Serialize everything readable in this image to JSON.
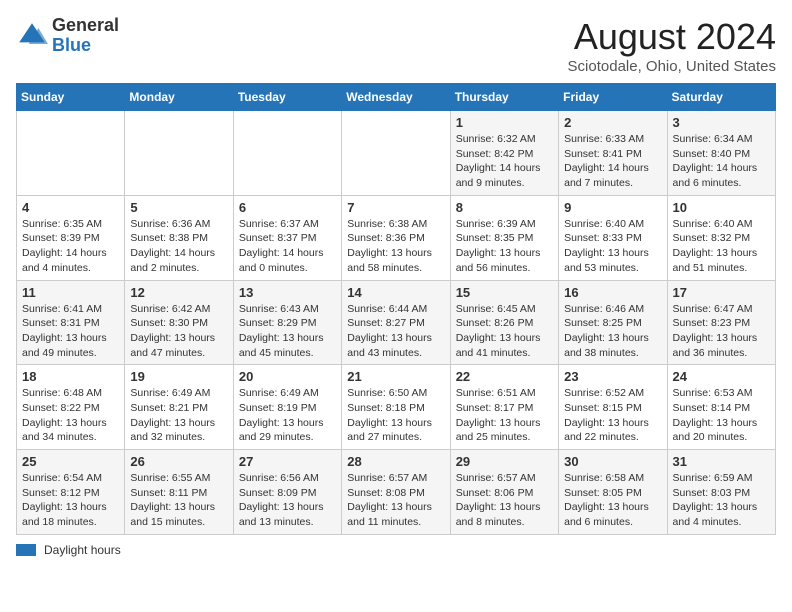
{
  "header": {
    "logo_general": "General",
    "logo_blue": "Blue",
    "month_title": "August 2024",
    "location": "Sciotodale, Ohio, United States"
  },
  "days_of_week": [
    "Sunday",
    "Monday",
    "Tuesday",
    "Wednesday",
    "Thursday",
    "Friday",
    "Saturday"
  ],
  "legend": {
    "label": "Daylight hours"
  },
  "weeks": [
    [
      {
        "day": "",
        "info": ""
      },
      {
        "day": "",
        "info": ""
      },
      {
        "day": "",
        "info": ""
      },
      {
        "day": "",
        "info": ""
      },
      {
        "day": "1",
        "info": "Sunrise: 6:32 AM\nSunset: 8:42 PM\nDaylight: 14 hours and 9 minutes."
      },
      {
        "day": "2",
        "info": "Sunrise: 6:33 AM\nSunset: 8:41 PM\nDaylight: 14 hours and 7 minutes."
      },
      {
        "day": "3",
        "info": "Sunrise: 6:34 AM\nSunset: 8:40 PM\nDaylight: 14 hours and 6 minutes."
      }
    ],
    [
      {
        "day": "4",
        "info": "Sunrise: 6:35 AM\nSunset: 8:39 PM\nDaylight: 14 hours and 4 minutes."
      },
      {
        "day": "5",
        "info": "Sunrise: 6:36 AM\nSunset: 8:38 PM\nDaylight: 14 hours and 2 minutes."
      },
      {
        "day": "6",
        "info": "Sunrise: 6:37 AM\nSunset: 8:37 PM\nDaylight: 14 hours and 0 minutes."
      },
      {
        "day": "7",
        "info": "Sunrise: 6:38 AM\nSunset: 8:36 PM\nDaylight: 13 hours and 58 minutes."
      },
      {
        "day": "8",
        "info": "Sunrise: 6:39 AM\nSunset: 8:35 PM\nDaylight: 13 hours and 56 minutes."
      },
      {
        "day": "9",
        "info": "Sunrise: 6:40 AM\nSunset: 8:33 PM\nDaylight: 13 hours and 53 minutes."
      },
      {
        "day": "10",
        "info": "Sunrise: 6:40 AM\nSunset: 8:32 PM\nDaylight: 13 hours and 51 minutes."
      }
    ],
    [
      {
        "day": "11",
        "info": "Sunrise: 6:41 AM\nSunset: 8:31 PM\nDaylight: 13 hours and 49 minutes."
      },
      {
        "day": "12",
        "info": "Sunrise: 6:42 AM\nSunset: 8:30 PM\nDaylight: 13 hours and 47 minutes."
      },
      {
        "day": "13",
        "info": "Sunrise: 6:43 AM\nSunset: 8:29 PM\nDaylight: 13 hours and 45 minutes."
      },
      {
        "day": "14",
        "info": "Sunrise: 6:44 AM\nSunset: 8:27 PM\nDaylight: 13 hours and 43 minutes."
      },
      {
        "day": "15",
        "info": "Sunrise: 6:45 AM\nSunset: 8:26 PM\nDaylight: 13 hours and 41 minutes."
      },
      {
        "day": "16",
        "info": "Sunrise: 6:46 AM\nSunset: 8:25 PM\nDaylight: 13 hours and 38 minutes."
      },
      {
        "day": "17",
        "info": "Sunrise: 6:47 AM\nSunset: 8:23 PM\nDaylight: 13 hours and 36 minutes."
      }
    ],
    [
      {
        "day": "18",
        "info": "Sunrise: 6:48 AM\nSunset: 8:22 PM\nDaylight: 13 hours and 34 minutes."
      },
      {
        "day": "19",
        "info": "Sunrise: 6:49 AM\nSunset: 8:21 PM\nDaylight: 13 hours and 32 minutes."
      },
      {
        "day": "20",
        "info": "Sunrise: 6:49 AM\nSunset: 8:19 PM\nDaylight: 13 hours and 29 minutes."
      },
      {
        "day": "21",
        "info": "Sunrise: 6:50 AM\nSunset: 8:18 PM\nDaylight: 13 hours and 27 minutes."
      },
      {
        "day": "22",
        "info": "Sunrise: 6:51 AM\nSunset: 8:17 PM\nDaylight: 13 hours and 25 minutes."
      },
      {
        "day": "23",
        "info": "Sunrise: 6:52 AM\nSunset: 8:15 PM\nDaylight: 13 hours and 22 minutes."
      },
      {
        "day": "24",
        "info": "Sunrise: 6:53 AM\nSunset: 8:14 PM\nDaylight: 13 hours and 20 minutes."
      }
    ],
    [
      {
        "day": "25",
        "info": "Sunrise: 6:54 AM\nSunset: 8:12 PM\nDaylight: 13 hours and 18 minutes."
      },
      {
        "day": "26",
        "info": "Sunrise: 6:55 AM\nSunset: 8:11 PM\nDaylight: 13 hours and 15 minutes."
      },
      {
        "day": "27",
        "info": "Sunrise: 6:56 AM\nSunset: 8:09 PM\nDaylight: 13 hours and 13 minutes."
      },
      {
        "day": "28",
        "info": "Sunrise: 6:57 AM\nSunset: 8:08 PM\nDaylight: 13 hours and 11 minutes."
      },
      {
        "day": "29",
        "info": "Sunrise: 6:57 AM\nSunset: 8:06 PM\nDaylight: 13 hours and 8 minutes."
      },
      {
        "day": "30",
        "info": "Sunrise: 6:58 AM\nSunset: 8:05 PM\nDaylight: 13 hours and 6 minutes."
      },
      {
        "day": "31",
        "info": "Sunrise: 6:59 AM\nSunset: 8:03 PM\nDaylight: 13 hours and 4 minutes."
      }
    ]
  ]
}
